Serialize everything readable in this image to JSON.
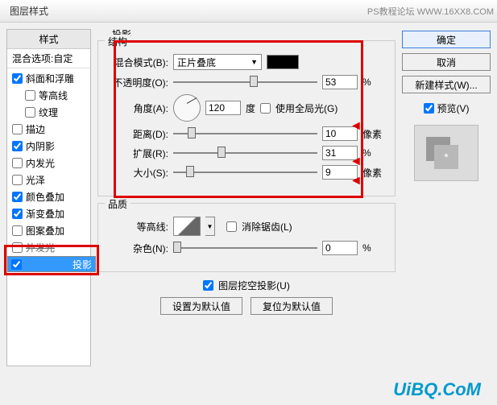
{
  "window": {
    "title": "图层样式",
    "watermark": "PS教程论坛  WWW.16XX8.COM"
  },
  "left": {
    "header": "样式",
    "sub": "混合选项:自定",
    "items": [
      {
        "label": "斜面和浮雕",
        "checked": true,
        "indent": false
      },
      {
        "label": "等高线",
        "checked": false,
        "indent": true
      },
      {
        "label": "纹理",
        "checked": false,
        "indent": true
      },
      {
        "label": "描边",
        "checked": false,
        "indent": false
      },
      {
        "label": "内阴影",
        "checked": true,
        "indent": false
      },
      {
        "label": "内发光",
        "checked": false,
        "indent": false
      },
      {
        "label": "光泽",
        "checked": false,
        "indent": false
      },
      {
        "label": "颜色叠加",
        "checked": true,
        "indent": false
      },
      {
        "label": "渐变叠加",
        "checked": true,
        "indent": false
      },
      {
        "label": "图案叠加",
        "checked": false,
        "indent": false
      },
      {
        "label": "外发光",
        "checked": false,
        "indent": false,
        "strike": true
      },
      {
        "label": "投影",
        "checked": true,
        "indent": false,
        "selected": true
      }
    ]
  },
  "center": {
    "title": "投影",
    "struct": {
      "title": "结构",
      "blendMode": {
        "label": "混合模式(B):",
        "value": "正片叠底"
      },
      "opacity": {
        "label": "不透明度(O):",
        "value": "53",
        "unit": "%",
        "pos": 53
      },
      "angle": {
        "label": "角度(A):",
        "value": "120",
        "unit": "度",
        "globalLabel": "使用全局光(G)",
        "globalChecked": false
      },
      "distance": {
        "label": "距离(D):",
        "value": "10",
        "unit": "像素",
        "pos": 10
      },
      "spread": {
        "label": "扩展(R):",
        "value": "31",
        "unit": "%",
        "pos": 31
      },
      "size": {
        "label": "大小(S):",
        "value": "9",
        "unit": "像素",
        "pos": 9
      }
    },
    "quality": {
      "title": "品质",
      "contour": {
        "label": "等高线:",
        "antialiasLabel": "消除锯齿(L)",
        "antialiasChecked": false
      },
      "noise": {
        "label": "杂色(N):",
        "value": "0",
        "unit": "%",
        "pos": 0
      }
    },
    "knockout": {
      "label": "图层挖空投影(U)",
      "checked": true
    },
    "defaults": {
      "set": "设置为默认值",
      "reset": "复位为默认值"
    }
  },
  "right": {
    "ok": "确定",
    "cancel": "取消",
    "newStyle": "新建样式(W)...",
    "previewLabel": "预览(V)",
    "previewChecked": true
  },
  "footer": "UiBQ.CoM"
}
